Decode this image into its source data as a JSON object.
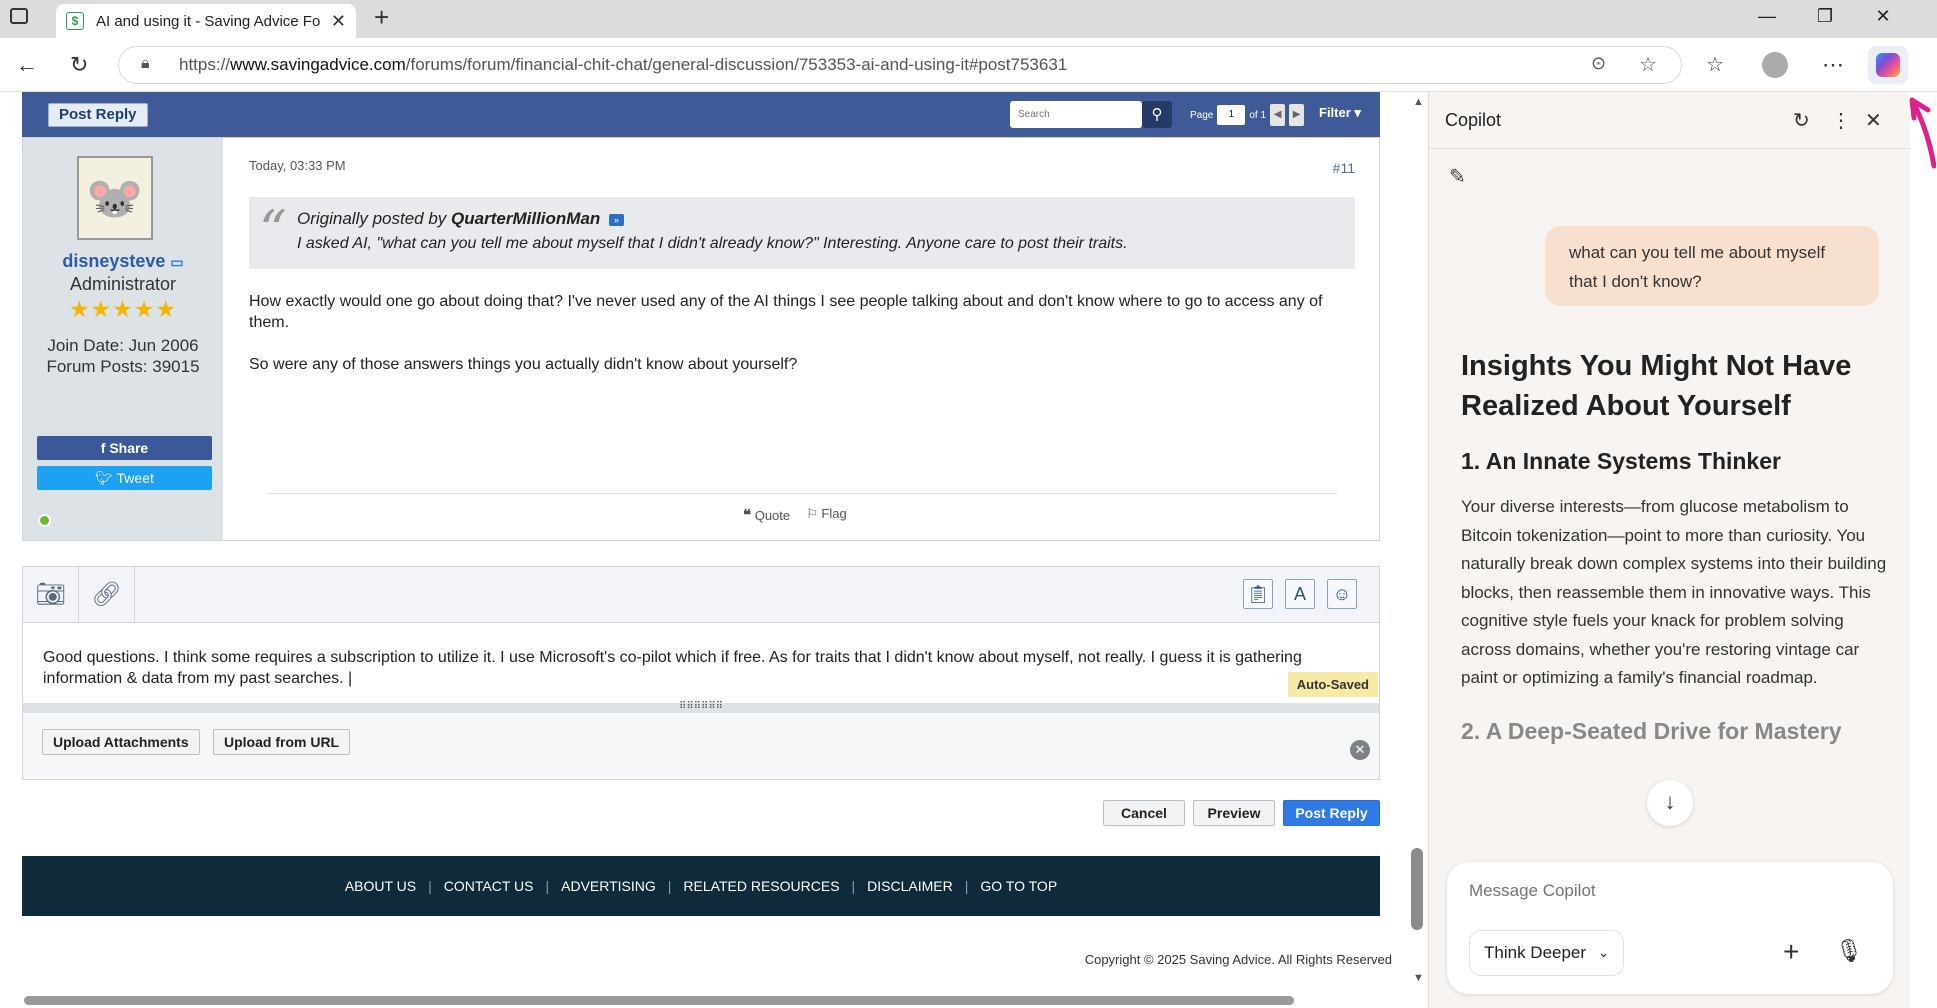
{
  "browser": {
    "tab_title": "AI and using it - Saving Advice Fo",
    "tab_favicon": "$",
    "new_tab": "+",
    "url_prefix": "https://",
    "url_domain": "www.savingadvice.com",
    "url_path": "/forums/forum/financial-chit-chat/general-discussion/753353-ai-and-using-it#post753631",
    "minimize": "—",
    "maximize": "❐",
    "close": "✕"
  },
  "forum_bar": {
    "post_reply": "Post Reply",
    "search_placeholder": "Search",
    "page_label": "Page",
    "page_current": "1",
    "page_of": "of 1",
    "filter": "Filter"
  },
  "post": {
    "user": {
      "name": "disneysteve",
      "role": "Administrator",
      "stars": "★★★★★",
      "join_date": "Join Date: Jun 2006",
      "forum_posts": "Forum Posts: 39015",
      "share": "Share",
      "tweet": "Tweet"
    },
    "date": "Today, 03:33 PM",
    "number": "#11",
    "quote": {
      "prefix": "Originally posted by",
      "author": "QuarterMillionMan",
      "text": "I asked AI, \"what can you tell me about myself that I didn't already know?\" Interesting. Anyone care to post their traits."
    },
    "paragraphs": [
      "How exactly would one go about doing that? I've never used any of the AI things I see people talking about and don't know where to go to access any of them.",
      "So were any of those answers things you actually didn't know about yourself?"
    ],
    "actions": {
      "quote": "Quote",
      "flag": "Flag"
    }
  },
  "editor": {
    "text": "Good questions. I think some requires a subscription to utilize it. I use Microsoft's co-pilot which if free. As for traits that I didn't know about myself, not really. I guess it is gathering information & data from my past searches. |",
    "auto_saved": "Auto-Saved",
    "upload_attachments": "Upload Attachments",
    "upload_url": "Upload from URL"
  },
  "form_buttons": {
    "cancel": "Cancel",
    "preview": "Preview",
    "post_reply": "Post Reply"
  },
  "footer": {
    "links": [
      "ABOUT US",
      "CONTACT US",
      "ADVERTISING",
      "RELATED RESOURCES",
      "DISCLAIMER",
      "GO TO TOP"
    ],
    "copyright": "Copyright © 2025 Saving Advice. All Rights Reserved"
  },
  "copilot": {
    "title": "Copilot",
    "user_message": "what can you tell me about myself that I don't know?",
    "response_title": "Insights You Might Not Have Realized About Yourself",
    "section1_heading": "1. An Innate Systems Thinker",
    "section1_text": "Your diverse interests—from glucose metabolism to Bitcoin tokenization—point to more than curiosity. You naturally break down complex systems into their building blocks, then reassemble them in innovative ways. This cognitive style fuels your knack for problem solving across domains, whether you're restoring vintage car paint or optimizing a family's financial roadmap.",
    "section2_heading": "2. A Deep-Seated Drive for Mastery",
    "input_placeholder": "Message Copilot",
    "mode": "Think Deeper"
  },
  "colors": {
    "forum_bar": "#3f5a96",
    "footer": "#0f2a3a",
    "post_reply_button": "#2f7ae5",
    "copilot_bubble": "#f8e0cf",
    "annotation_arrow": "#e0218a"
  }
}
